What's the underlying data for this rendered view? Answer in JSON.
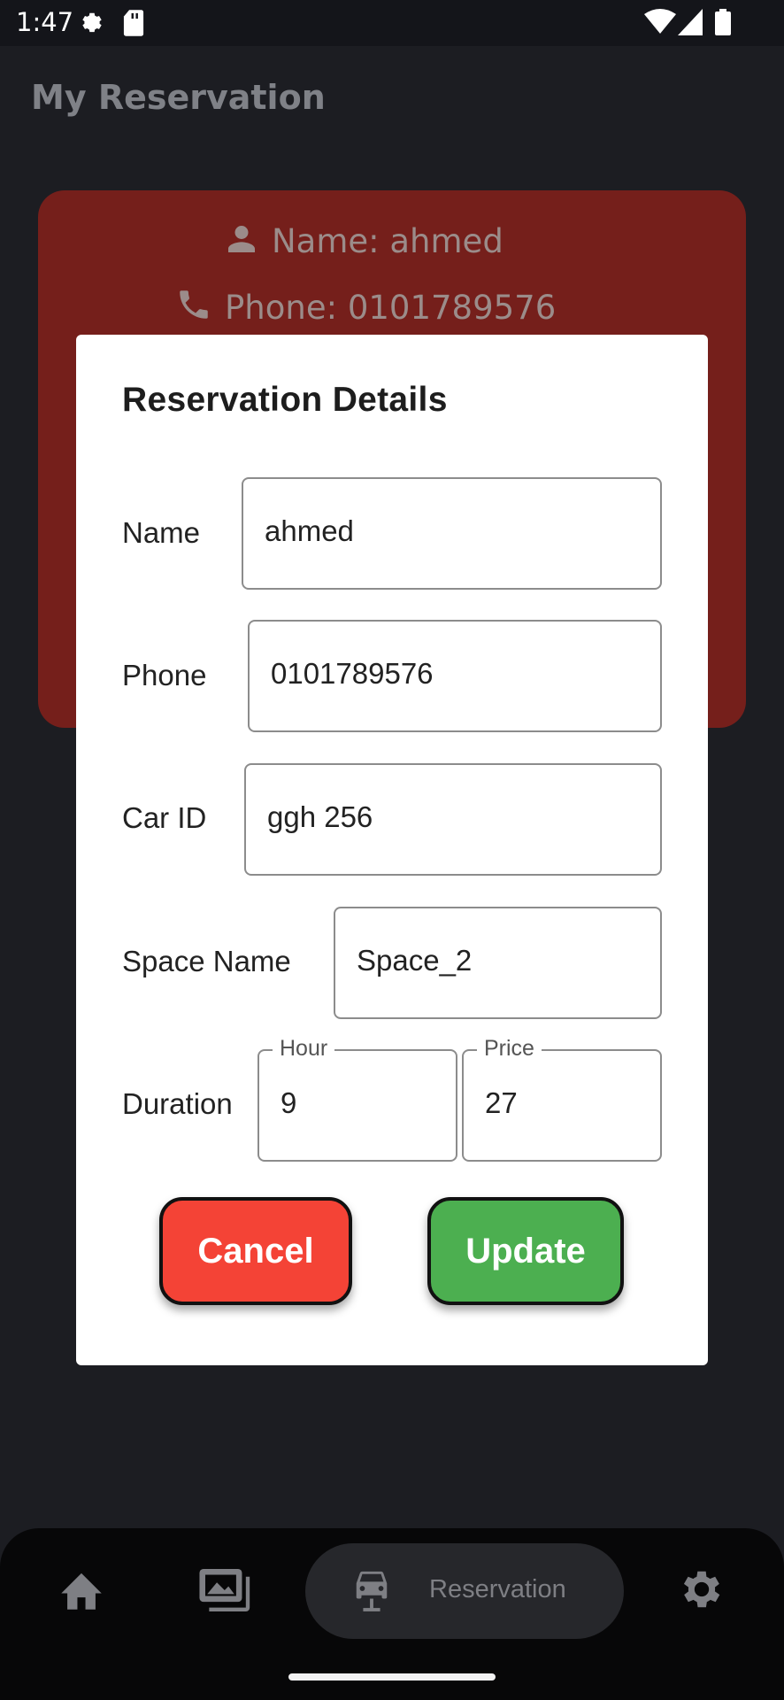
{
  "status_bar": {
    "time": "1:47"
  },
  "app_bar": {
    "title": "My Reservation"
  },
  "card": {
    "name_line": "Name: ahmed",
    "phone_line": "Phone: 0101789576"
  },
  "dialog": {
    "title": "Reservation Details",
    "name_label": "Name",
    "name_value": "ahmed",
    "phone_label": "Phone",
    "phone_value": "0101789576",
    "car_label": "Car ID",
    "car_value": "ggh 256",
    "space_label": "Space Name",
    "space_value": "Space_2",
    "duration_label": "Duration",
    "hour_label": "Hour",
    "hour_value": "9",
    "price_label": "Price",
    "price_value": "27",
    "cancel_label": "Cancel",
    "update_label": "Update"
  },
  "bottom_nav": {
    "items": [
      "home-icon",
      "gallery-icon",
      "car-icon",
      "settings-icon"
    ],
    "selected_label": "Reservation"
  },
  "colors": {
    "card_bg": "#751f1b",
    "cancel": "#f44336",
    "update": "#4caf50"
  }
}
